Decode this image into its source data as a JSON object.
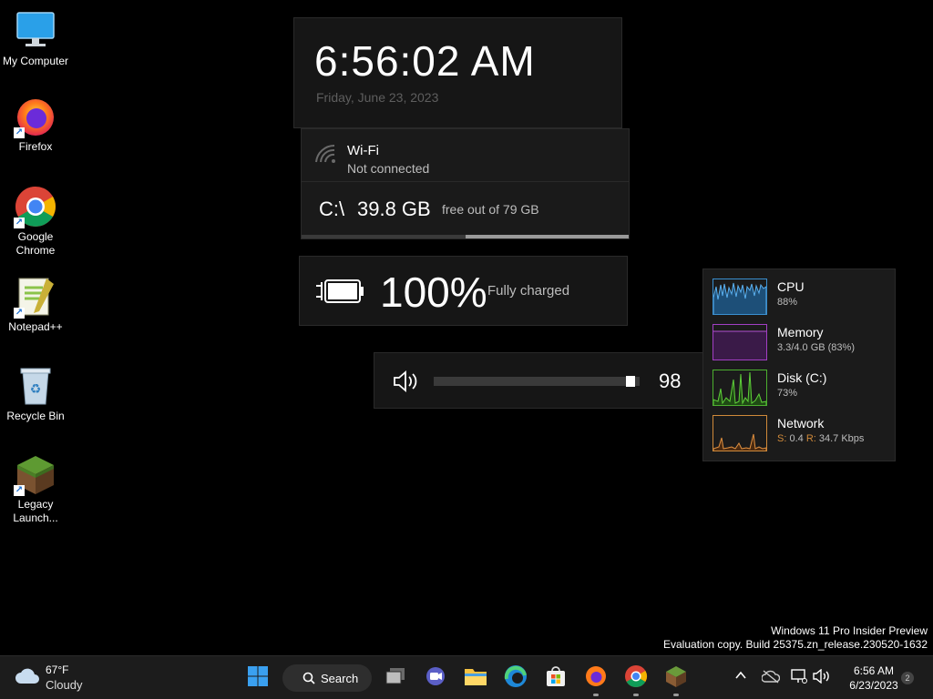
{
  "desktop": {
    "icons": [
      {
        "label": "My Computer"
      },
      {
        "label": "Firefox"
      },
      {
        "label": "Google\nChrome"
      },
      {
        "label": "Notepad++"
      },
      {
        "label": "Recycle Bin"
      },
      {
        "label": "Legacy\nLaunch..."
      }
    ]
  },
  "clock_widget": {
    "time": "6:56:02 AM",
    "date": "Friday, June 23, 2023"
  },
  "wifi_widget": {
    "name": "Wi-Fi",
    "status": "Not connected"
  },
  "disk_widget": {
    "drive": "C:\\",
    "free": "39.8 GB",
    "desc": "free out of 79 GB",
    "free_fraction": 0.5
  },
  "battery_widget": {
    "percent": "100%",
    "status": "Fully charged",
    "level": 1.0
  },
  "volume_widget": {
    "value": "98",
    "level": 0.98
  },
  "performance": {
    "items": [
      {
        "title": "CPU",
        "sub": "88%",
        "color": "#3a8fd0",
        "icon": "cpu-graph"
      },
      {
        "title": "Memory",
        "sub": "3.3/4.0 GB (83%)",
        "color": "#a23fc4",
        "icon": "memory-graph"
      },
      {
        "title": "Disk (C:)",
        "sub": "73%",
        "color": "#4caf2f",
        "icon": "disk-graph"
      },
      {
        "title": "Network",
        "sub_s_label": "S:",
        "sub_s": " 0.4 ",
        "sub_r_label": "R:",
        "sub_r": " 34.7 Kbps",
        "color": "#d08a3a",
        "icon": "network-graph"
      }
    ]
  },
  "watermark": {
    "line1": "Windows 11 Pro Insider Preview",
    "line2": "Evaluation copy. Build 25375.zn_release.230520-1632"
  },
  "taskbar": {
    "weather_temp": "67°F",
    "weather_cond": "Cloudy",
    "search_label": "Search",
    "time": "6:56 AM",
    "date": "6/23/2023",
    "notifications": "2"
  }
}
